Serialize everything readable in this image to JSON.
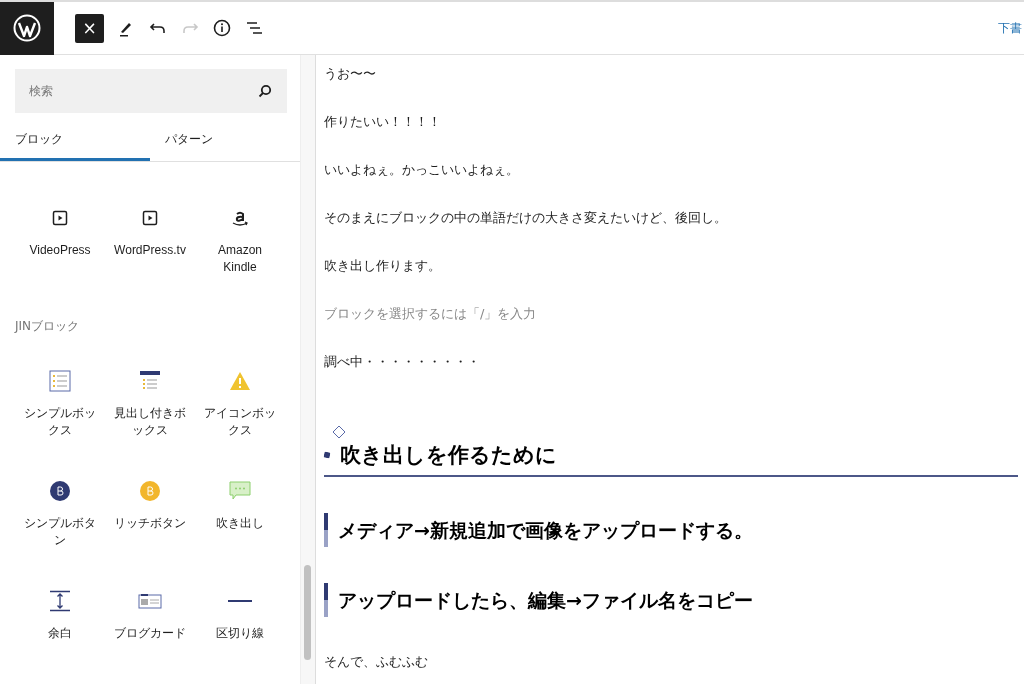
{
  "toolbar": {
    "close": "×",
    "draft": "下書"
  },
  "search": {
    "placeholder": "検索"
  },
  "tabs": [
    {
      "label": "ブロック",
      "selected": true
    },
    {
      "label": "パターン",
      "selected": false
    }
  ],
  "block_groups": [
    {
      "blocks": [
        {
          "label": "VideoPress",
          "kind": "video"
        },
        {
          "label": "WordPress.tv",
          "kind": "video"
        },
        {
          "label": "Amazon Kindle",
          "kind": "amazon"
        }
      ]
    },
    {
      "title": "JINブロック",
      "blocks": [
        {
          "label": "シンプルボックス",
          "kind": "list-box"
        },
        {
          "label": "見出し付きボックス",
          "kind": "heading-box"
        },
        {
          "label": "アイコンボックス",
          "kind": "warning"
        },
        {
          "label": "シンプルボタン",
          "kind": "simple-button"
        },
        {
          "label": "リッチボタン",
          "kind": "rich-button"
        },
        {
          "label": "吹き出し",
          "kind": "balloon"
        },
        {
          "label": "余白",
          "kind": "spacer"
        },
        {
          "label": "ブログカード",
          "kind": "card"
        },
        {
          "label": "区切り線",
          "kind": "separator"
        }
      ]
    }
  ],
  "content": [
    {
      "kind": "paragraph",
      "text": "うお〜〜"
    },
    {
      "kind": "paragraph",
      "text": "作りたいい！！！！"
    },
    {
      "kind": "paragraph",
      "text": "いいよねぇ。かっこいいよねぇ。"
    },
    {
      "kind": "paragraph",
      "text": "そのまえにブロックの中の単語だけの大きさ変えたいけど、後回し。"
    },
    {
      "kind": "paragraph",
      "text": "吹き出し作ります。"
    },
    {
      "kind": "placeholder",
      "text": "ブロックを選択するには「/」を入力"
    },
    {
      "kind": "paragraph",
      "text": "調べ中・・・・・・・・・"
    },
    {
      "kind": "heading2",
      "text": "吹き出しを作るために"
    },
    {
      "kind": "heading3",
      "text": "メディア→新規追加で画像をアップロードする。"
    },
    {
      "kind": "heading3",
      "text": "アップロードしたら、編集→ファイル名をコピー"
    },
    {
      "kind": "paragraph",
      "text": "そんで、ふむふむ"
    }
  ]
}
